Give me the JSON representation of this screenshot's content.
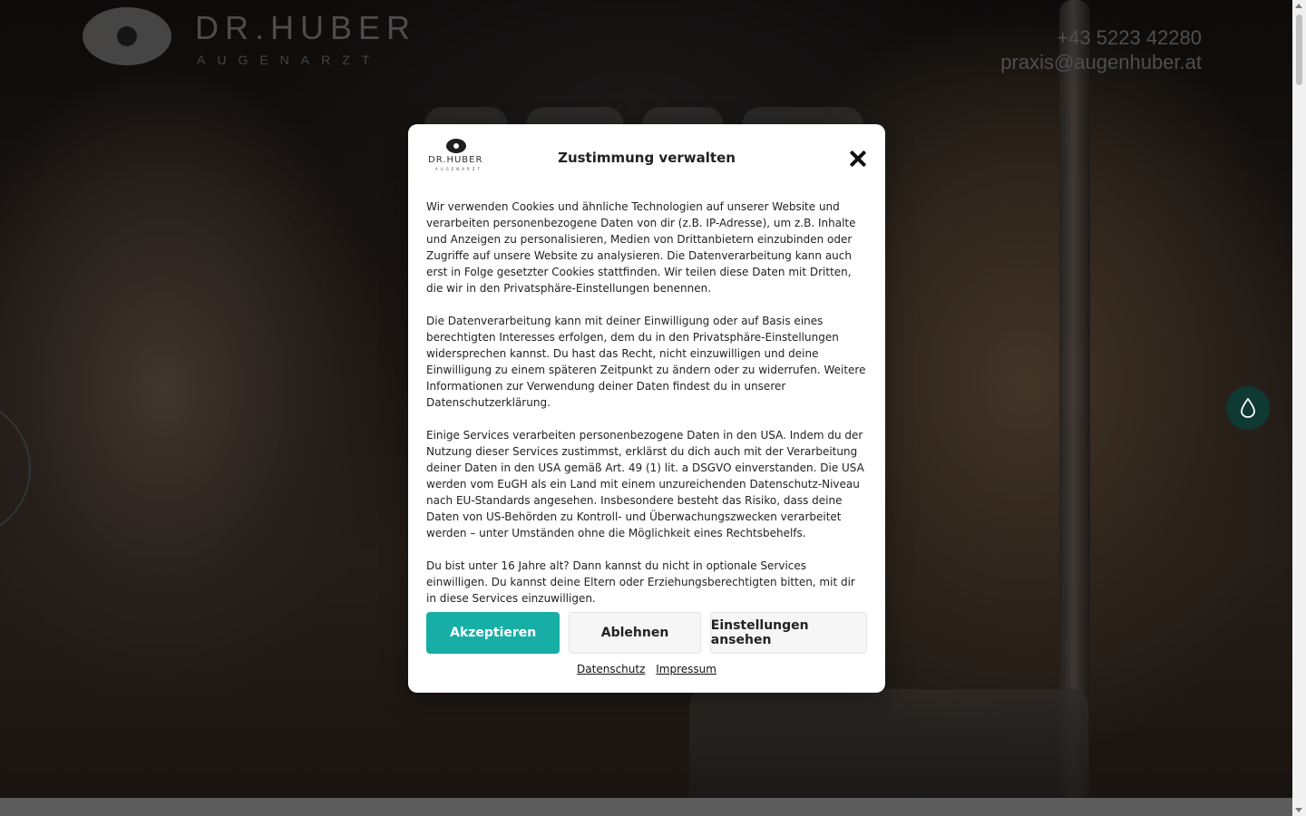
{
  "header": {
    "logo_name": "DR.HUBER",
    "logo_sub": "AUGENARZT",
    "phone": "+43 5223 42280",
    "email": "praxis@augenhuber.at"
  },
  "colors": {
    "accent": "#17aea6",
    "float_button": "#0f3a34"
  },
  "float_button": {
    "icon": "drop-icon"
  },
  "modal": {
    "logo_name": "DR.HUBER",
    "logo_sub": "AUGENARZT",
    "title": "Zustimmung verwalten",
    "paragraphs": [
      "Wir verwenden Cookies und ähnliche Technologien auf unserer Website und verarbeiten personenbezogene Daten von dir (z.B. IP-Adresse), um z.B. Inhalte und Anzeigen zu personalisieren, Medien von Drittanbietern einzubinden oder Zugriffe auf unsere Website zu analysieren. Die Datenverarbeitung kann auch erst in Folge gesetzter Cookies stattfinden. Wir teilen diese Daten mit Dritten, die wir in den Privatsphäre-Einstellungen benennen.",
      "Die Datenverarbeitung kann mit deiner Einwilligung oder auf Basis eines berechtigten Interesses erfolgen, dem du in den Privatsphäre-Einstellungen widersprechen kannst. Du hast das Recht, nicht einzuwilligen und deine Einwilligung zu einem späteren Zeitpunkt zu ändern oder zu widerrufen. Weitere Informationen zur Verwendung deiner Daten findest du in unserer Datenschutzerklärung.",
      "Einige Services verarbeiten personenbezogene Daten in den USA. Indem du der Nutzung dieser Services zustimmst, erklärst du dich auch mit der Verarbeitung deiner Daten in den USA gemäß Art. 49 (1) lit. a DSGVO einverstanden. Die USA werden vom EuGH als ein Land mit einem unzureichenden Datenschutz-Niveau nach EU-Standards angesehen. Insbesondere besteht das Risiko, dass deine Daten von US-Behörden zu Kontroll- und Überwachungszwecken verarbeitet werden – unter Umständen ohne die Möglichkeit eines Rechtsbehelfs.",
      "Du bist unter 16 Jahre alt? Dann kannst du nicht in optionale Services einwilligen. Du kannst deine Eltern oder Erziehungsberechtigten bitten, mit dir in diese Services einzuwilligen."
    ],
    "buttons": {
      "accept": "Akzeptieren",
      "deny": "Ablehnen",
      "settings": "Einstellungen ansehen"
    },
    "links": {
      "privacy": "Datenschutz",
      "imprint": "Impressum"
    }
  }
}
